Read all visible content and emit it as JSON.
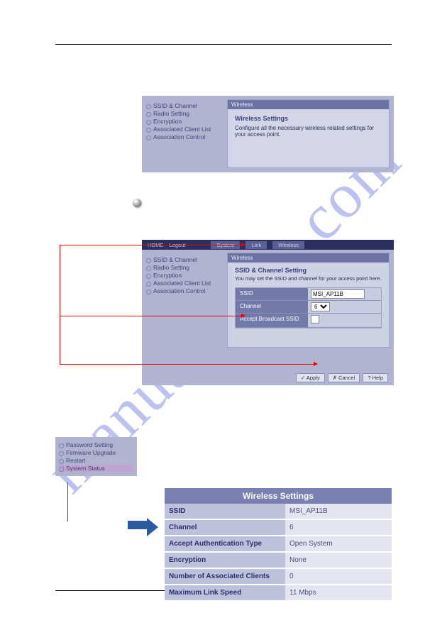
{
  "panel1": {
    "sidebar": [
      "SSID & Channel",
      "Radio Setting",
      "Encryption",
      "Associated Client List",
      "Association Control"
    ],
    "titlebar": "Wireless",
    "heading": "Wireless Settings",
    "body": "Configure all the necessary wireless related settings for your access point."
  },
  "panel2": {
    "nav": {
      "home": "HOME",
      "logout": "Logout",
      "tabs": [
        "System",
        "Link",
        "Wireless"
      ]
    },
    "sidebar": [
      "SSID & Channel",
      "Radio Setting",
      "Encryption",
      "Associated Client List",
      "Association Control"
    ],
    "titlebar": "Wireless",
    "heading": "SSID & Channel Setting",
    "body": "You may set the SSID and channel for your access point here.",
    "rows": {
      "ssid_label": "SSID",
      "ssid_value": "MSI_AP11B",
      "channel_label": "Channel",
      "channel_value": "6",
      "abssid_label": "Accept Broadcast SSID"
    },
    "buttons": {
      "apply": "✓ Apply",
      "cancel": "✗ Cancel",
      "help": "? Help"
    }
  },
  "sidebar3": [
    "Password Setting",
    "Firmware Upgrade",
    "Restart",
    "System Status"
  ],
  "table3": {
    "title": "Wireless Settings",
    "rows": [
      {
        "k": "SSID",
        "v": "MSI_AP11B"
      },
      {
        "k": "Channel",
        "v": "6"
      },
      {
        "k": "Accept Authentication Type",
        "v": "Open System"
      },
      {
        "k": "Encryption",
        "v": "None"
      },
      {
        "k": "Number of Associated Clients",
        "v": "0"
      },
      {
        "k": "Maximum Link Speed",
        "v": "11 Mbps"
      }
    ]
  }
}
